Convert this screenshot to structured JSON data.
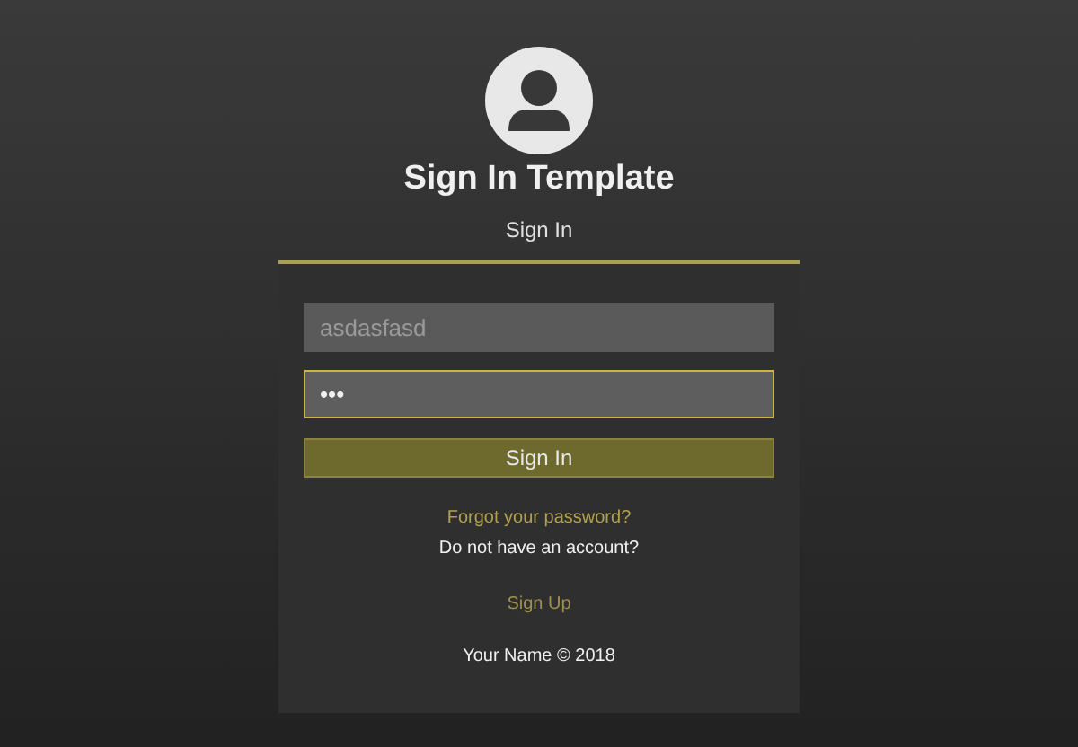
{
  "header": {
    "title": "Sign In Template",
    "subtitle": "Sign In"
  },
  "form": {
    "username": {
      "value": "asdasfasd",
      "focused": false
    },
    "password": {
      "value": "•••",
      "focused": true
    },
    "submit": "Sign In",
    "forgot_link": "Forgot your password?",
    "no_account_text": "Do not have an account?",
    "signup_link": "Sign Up",
    "footer": "Your Name © 2018"
  }
}
